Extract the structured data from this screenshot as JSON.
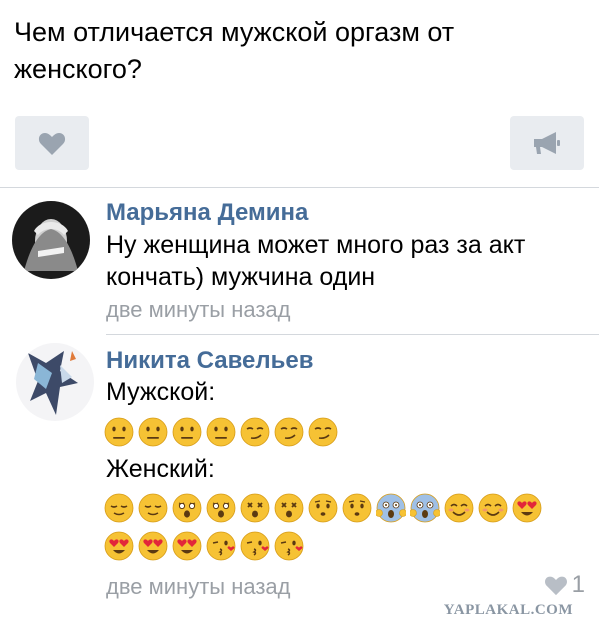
{
  "post": {
    "text": "Чем отличается мужской оргазм от женского?"
  },
  "actions": {
    "like_icon": "heart-icon",
    "share_icon": "megaphone-icon"
  },
  "comments": [
    {
      "author": "Марьяна Демина",
      "text": "Ну женщина может много раз за акт кончать) мужчина один",
      "time": "две минуты назад"
    },
    {
      "author": "Никита Савельев",
      "line1": "Мужской:",
      "male_emojis": [
        "neutral",
        "neutral",
        "neutral",
        "neutral",
        "smirk",
        "smirk",
        "smirk"
      ],
      "line2": "Женский:",
      "female_emojis_row1": [
        "relieved",
        "relieved",
        "astonished",
        "astonished",
        "dizzy",
        "dizzy",
        "worried",
        "worried",
        "scream",
        "scream",
        "blush",
        "blush",
        "heart-eyes"
      ],
      "female_emojis_row2": [
        "heart-eyes",
        "heart-eyes",
        "heart-eyes",
        "kiss",
        "kiss",
        "kiss"
      ],
      "time": "две минуты назад",
      "likes": "1"
    }
  ],
  "watermark": "YAPLAKAL.COM"
}
